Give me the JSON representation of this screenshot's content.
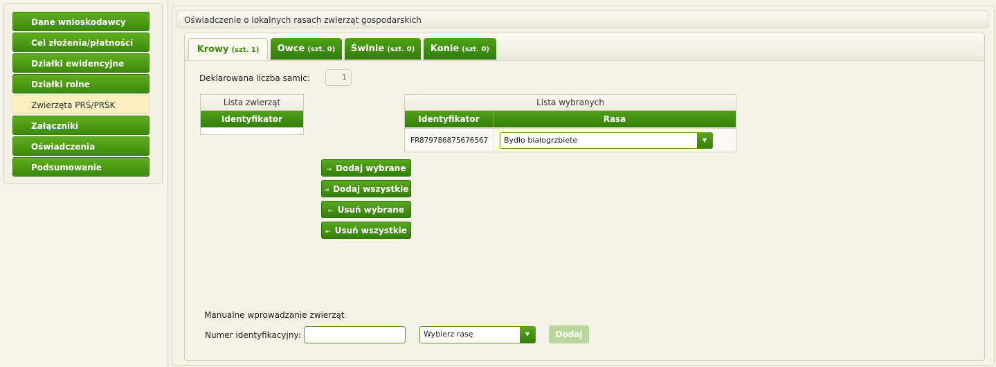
{
  "sidebar": {
    "items": [
      {
        "label": "Dane wnioskodawcy"
      },
      {
        "label": "Cel złożenia/płatności"
      },
      {
        "label": "Działki ewidencyjne"
      },
      {
        "label": "Działki rolne"
      },
      {
        "label": "Zwierzęta PRŚ/PRŚK"
      },
      {
        "label": "Załączniki"
      },
      {
        "label": "Oświadczenia"
      },
      {
        "label": "Podsumowanie"
      }
    ],
    "active_index": 4
  },
  "main": {
    "title": "Oświadczenie o lokalnych rasach zwierząt gospodarskich",
    "tabs": [
      {
        "label": "Krowy",
        "count": "(szt. 1)"
      },
      {
        "label": "Owce",
        "count": "(szt. 0)"
      },
      {
        "label": "Świnie",
        "count": "(szt. 0)"
      },
      {
        "label": "Konie",
        "count": "(szt. 0)"
      }
    ],
    "declared_label": "Deklarowana liczba samic:",
    "declared_value": "1",
    "animal_list": {
      "caption": "Lista zwierząt",
      "column": "Identyfikator"
    },
    "selected_list": {
      "caption": "Lista wybranych",
      "columns": [
        "Identyfikator",
        "Rasa"
      ],
      "rows": [
        {
          "id": "FR879786875676567",
          "breed": "Bydło białogrzbiete"
        }
      ]
    },
    "actions": {
      "add_selected": "Dodaj wybrane",
      "add_all": "Dodaj wszystkie",
      "remove_selected": "Usuń wybrane",
      "remove_all": "Usuń wszystkie"
    },
    "manual": {
      "heading": "Manualne wprowadzanie zwierząt",
      "id_label": "Numer identyfikacyjny:",
      "id_value": "",
      "breed_placeholder": "Wybierz rasę",
      "add_label": "Dodaj"
    }
  },
  "colors": {
    "green_dark": "#347f09",
    "green_light": "#58a81b",
    "active_nav": "#fdf0c0",
    "disabled_button": "#b9d79a"
  }
}
